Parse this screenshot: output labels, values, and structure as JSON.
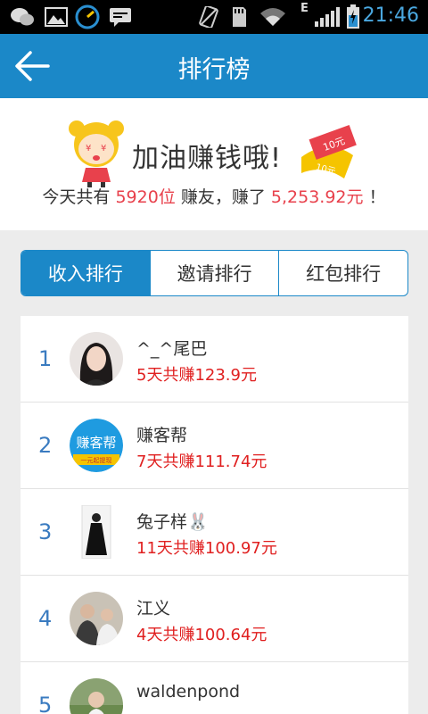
{
  "status_bar": {
    "time": "21:46",
    "icons": [
      "wechat-icon",
      "gallery-icon",
      "speedometer-icon",
      "chat-icon",
      "no-sim-icon",
      "sd-card-icon",
      "wifi-icon",
      "signal-icon",
      "battery-charging-icon"
    ],
    "network_label": "E"
  },
  "app_bar": {
    "title": "排行榜",
    "back_icon": "back-arrow-icon"
  },
  "hero": {
    "slogan": "加油赚钱哦!",
    "coupon_text_1": "10元",
    "coupon_text_2": "10元",
    "stats_prefix": "今天共有 ",
    "users_count": "5920位",
    "stats_mid": " 赚友，赚了 ",
    "amount": "5,253.92元",
    "stats_suffix": " ！"
  },
  "tabs": [
    {
      "label": "收入排行",
      "active": true
    },
    {
      "label": "邀请排行",
      "active": false
    },
    {
      "label": "红包排行",
      "active": false
    }
  ],
  "ranking": [
    {
      "rank": "1",
      "name": "^_^尾巴",
      "earnings": "5天共赚123.9元",
      "avatar": "girl-portrait-avatar"
    },
    {
      "rank": "2",
      "name": "赚客帮",
      "earnings": "7天共赚111.74元",
      "avatar": "logo-avatar",
      "avatar_text": "赚客帮",
      "avatar_subtext": "一元起提现"
    },
    {
      "rank": "3",
      "name": "兔子样🐰",
      "earnings": "11天共赚100.97元",
      "avatar": "woman-dress-avatar"
    },
    {
      "rank": "4",
      "name": "江义",
      "earnings": "4天共赚100.64元",
      "avatar": "couple-avatar"
    },
    {
      "rank": "5",
      "name": "waldenpond",
      "earnings": "",
      "avatar": "outdoor-avatar"
    }
  ],
  "colors": {
    "accent": "#1b88c8",
    "highlight": "#e8414c",
    "earnings": "#e02020",
    "rank": "#3a7bc0"
  }
}
